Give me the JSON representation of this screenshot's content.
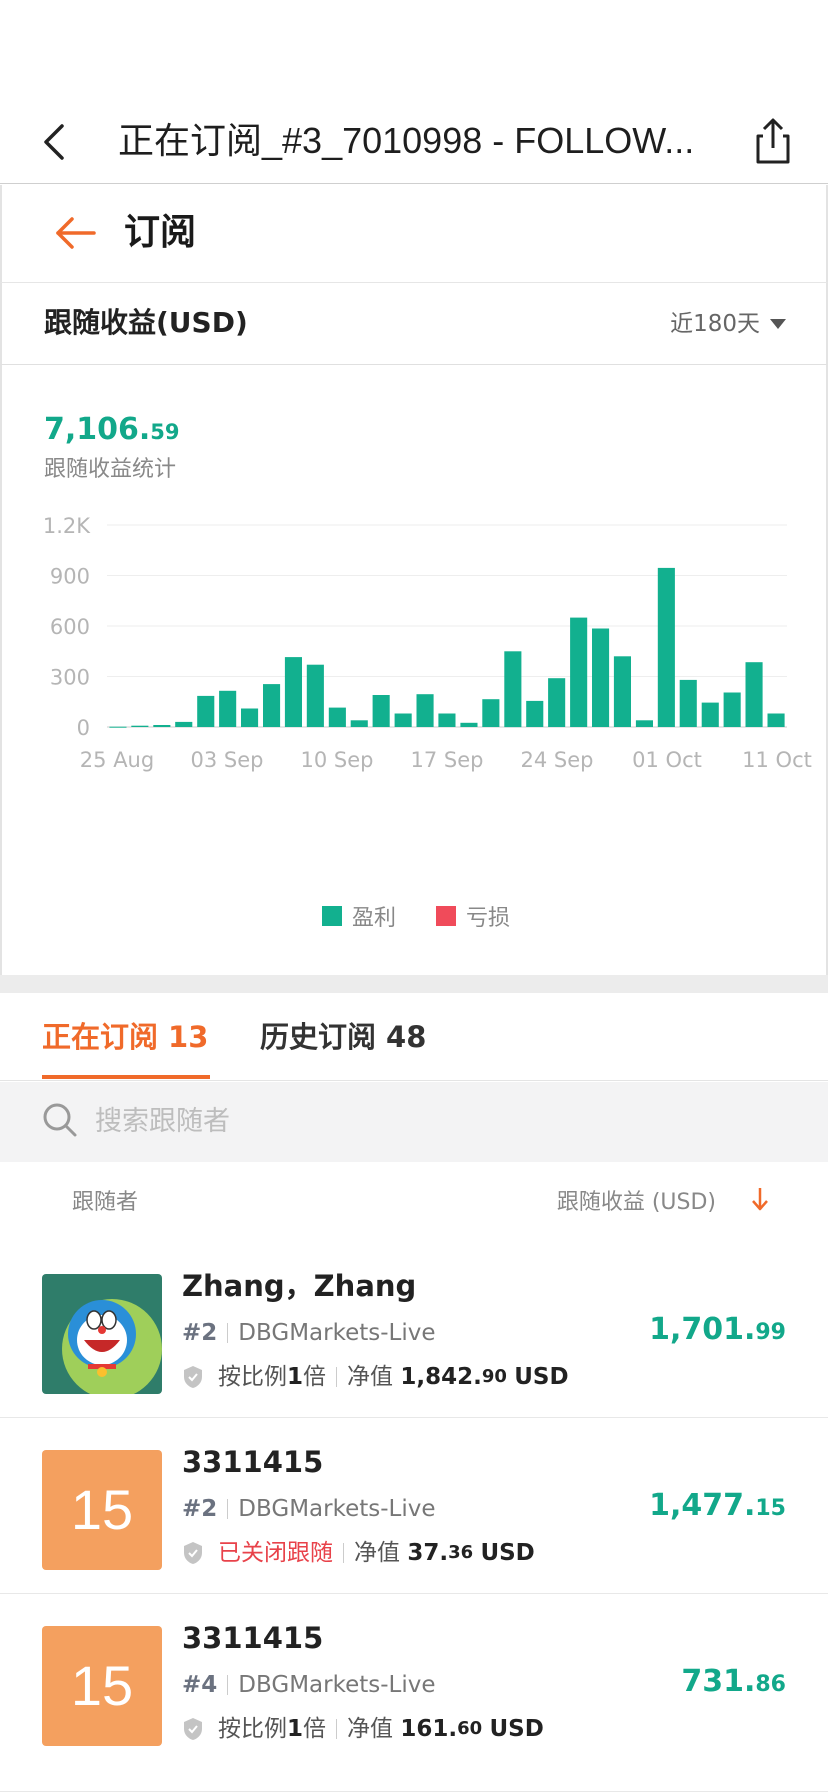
{
  "header": {
    "title": "正在订阅_#3_7010998 - FOLLOW...",
    "back_icon": "chevron-left-icon",
    "share_icon": "share-icon"
  },
  "subheader": {
    "label": "订阅",
    "back_arrow_icon": "arrow-left-icon",
    "accent": "#f06a2a"
  },
  "earnings": {
    "label": "跟随收益(USD)",
    "range": "近180天",
    "total_main": "7,106.",
    "total_decimal": "59",
    "total_caption": "跟随收益统计"
  },
  "chart_data": {
    "type": "bar",
    "x_ticks": [
      "25 Aug",
      "03 Sep",
      "10 Sep",
      "17 Sep",
      "24 Sep",
      "01 Oct",
      "11 Oct"
    ],
    "y_ticks": [
      "0",
      "300",
      "600",
      "900",
      "1.2K"
    ],
    "ylim": [
      0,
      1200
    ],
    "grid": true,
    "series": [
      {
        "name": "盈利",
        "color": "#12b08f",
        "values": [
          2,
          8,
          12,
          30,
          185,
          215,
          110,
          255,
          415,
          370,
          115,
          40,
          190,
          80,
          195,
          80,
          25,
          165,
          450,
          155,
          290,
          650,
          585,
          420,
          40,
          945,
          280,
          145,
          205,
          385,
          80
        ]
      },
      {
        "name": "亏损",
        "color": "#f04b5a",
        "values": []
      }
    ],
    "legend_position": "bottom"
  },
  "tabs": {
    "active_label": "正在订阅",
    "active_count": "13",
    "inactive_label": "历史订阅",
    "inactive_count": "48"
  },
  "search": {
    "placeholder": "搜索跟随者"
  },
  "list_head": {
    "left": "跟随者",
    "right": "跟随收益 (USD)"
  },
  "followers": [
    {
      "name": "Zhang，Zhang",
      "avatar": "cartoon-avatar",
      "rank": "#2",
      "server": "DBGMarkets-Live",
      "mode_prefix": "按比例",
      "mode_value": "1",
      "mode_suffix": "倍",
      "mode_closed": "",
      "equity_label": "净值",
      "equity_main": "1,842.",
      "equity_dec": "90",
      "equity_unit": "USD",
      "value_main": "1,701.",
      "value_dec": "99"
    },
    {
      "name": "3311415",
      "avatar_text": "15",
      "rank": "#2",
      "server": "DBGMarkets-Live",
      "mode_prefix": "",
      "mode_value": "",
      "mode_suffix": "",
      "mode_closed": "已关闭跟随",
      "equity_label": "净值",
      "equity_main": "37.",
      "equity_dec": "36",
      "equity_unit": "USD",
      "value_main": "1,477.",
      "value_dec": "15"
    },
    {
      "name": "3311415",
      "avatar_text": "15",
      "rank": "#4",
      "server": "DBGMarkets-Live",
      "mode_prefix": "按比例",
      "mode_value": "1",
      "mode_suffix": "倍",
      "mode_closed": "",
      "equity_label": "净值",
      "equity_main": "161.",
      "equity_dec": "60",
      "equity_unit": "USD",
      "value_main": "731.",
      "value_dec": "86"
    }
  ]
}
